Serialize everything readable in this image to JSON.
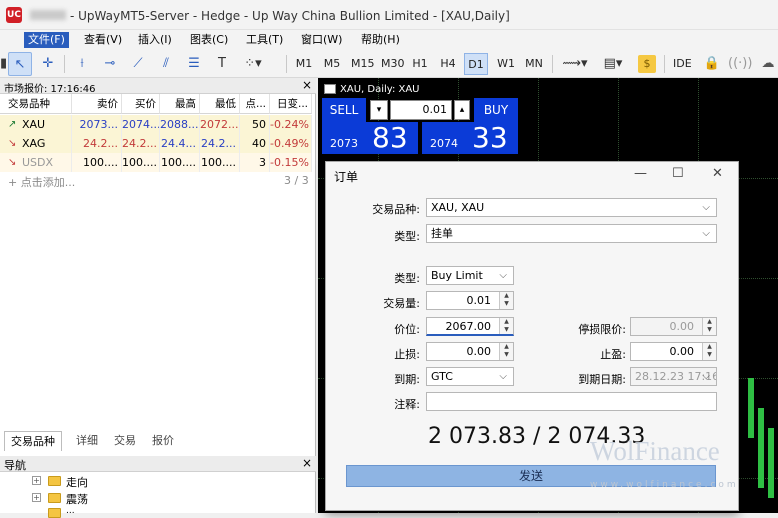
{
  "window": {
    "title": "- UpWayMT5-Server - Hedge - Up Way China Bullion Limited - [XAU,Daily]"
  },
  "menu": [
    "文件(F)",
    "查看(V)",
    "插入(I)",
    "图表(C)",
    "工具(T)",
    "窗口(W)",
    "帮助(H)"
  ],
  "timeframes": [
    "M1",
    "M5",
    "M15",
    "M30",
    "H1",
    "H4",
    "D1",
    "W1",
    "MN"
  ],
  "toolbar": {
    "ide_label": "IDE",
    "dollar_label": "$"
  },
  "market_watch": {
    "title": "市场报价: 17:16:46",
    "columns": [
      "交易品种",
      "卖价",
      "买价",
      "最高",
      "最低",
      "点...",
      "日变..."
    ],
    "rows": [
      {
        "symbol": "XAU",
        "bid": "2073...",
        "ask": "2074...",
        "high": "2088...",
        "low": "2072...",
        "spread": "50",
        "change": "-0.24%",
        "dir": "up"
      },
      {
        "symbol": "XAG",
        "bid": "24.2...",
        "ask": "24.2...",
        "high": "24.4...",
        "low": "24.2...",
        "spread": "40",
        "change": "-0.49%",
        "dir": "down"
      },
      {
        "symbol": "USDX",
        "bid": "100....",
        "ask": "100....",
        "high": "100....",
        "low": "100....",
        "spread": "3",
        "change": "-0.15%",
        "dir": "down"
      }
    ],
    "add_label": "+ 点击添加...",
    "count": "3 / 3",
    "colors": {
      "up": "#1e7b34",
      "down": "#c23a3a",
      "row_bg": "#fbf5d5",
      "row_bg_alt": "#fff8e8"
    }
  },
  "bottom_tabs": [
    "交易品种",
    "详细",
    "交易",
    "报价"
  ],
  "navigator": {
    "title": "导航",
    "items": [
      "走向",
      "震荡",
      "..."
    ]
  },
  "chart": {
    "label": "XAU, Daily: XAU",
    "sell_label": "SELL",
    "buy_label": "BUY",
    "volume": "0.01",
    "sell_small": "2073",
    "sell_big": "83",
    "buy_small": "2074",
    "buy_big": "33"
  },
  "order_dialog": {
    "title": "订单",
    "symbol_label": "交易品种:",
    "symbol_value": "XAU, XAU",
    "type_label": "类型:",
    "type_value": "挂单",
    "order_type_label": "类型:",
    "order_type_value": "Buy Limit",
    "volume_label": "交易量:",
    "volume_value": "0.01",
    "price_label": "价位:",
    "price_value": "2067.00",
    "stop_limit_label": "停损限价:",
    "stop_limit_value": "0.00",
    "sl_label": "止损:",
    "sl_value": "0.00",
    "tp_label": "止盈:",
    "tp_value": "0.00",
    "expiry_label": "到期:",
    "expiry_value": "GTC",
    "expiry_date_label": "到期日期:",
    "expiry_date_value": "28.12.23 17:16",
    "comment_label": "注释:",
    "comment_value": "",
    "quote": "2 073.83 / 2 074.33",
    "send_label": "发送"
  },
  "watermark": {
    "brand": "WolFinance",
    "url": "www.wolfinance.com"
  }
}
